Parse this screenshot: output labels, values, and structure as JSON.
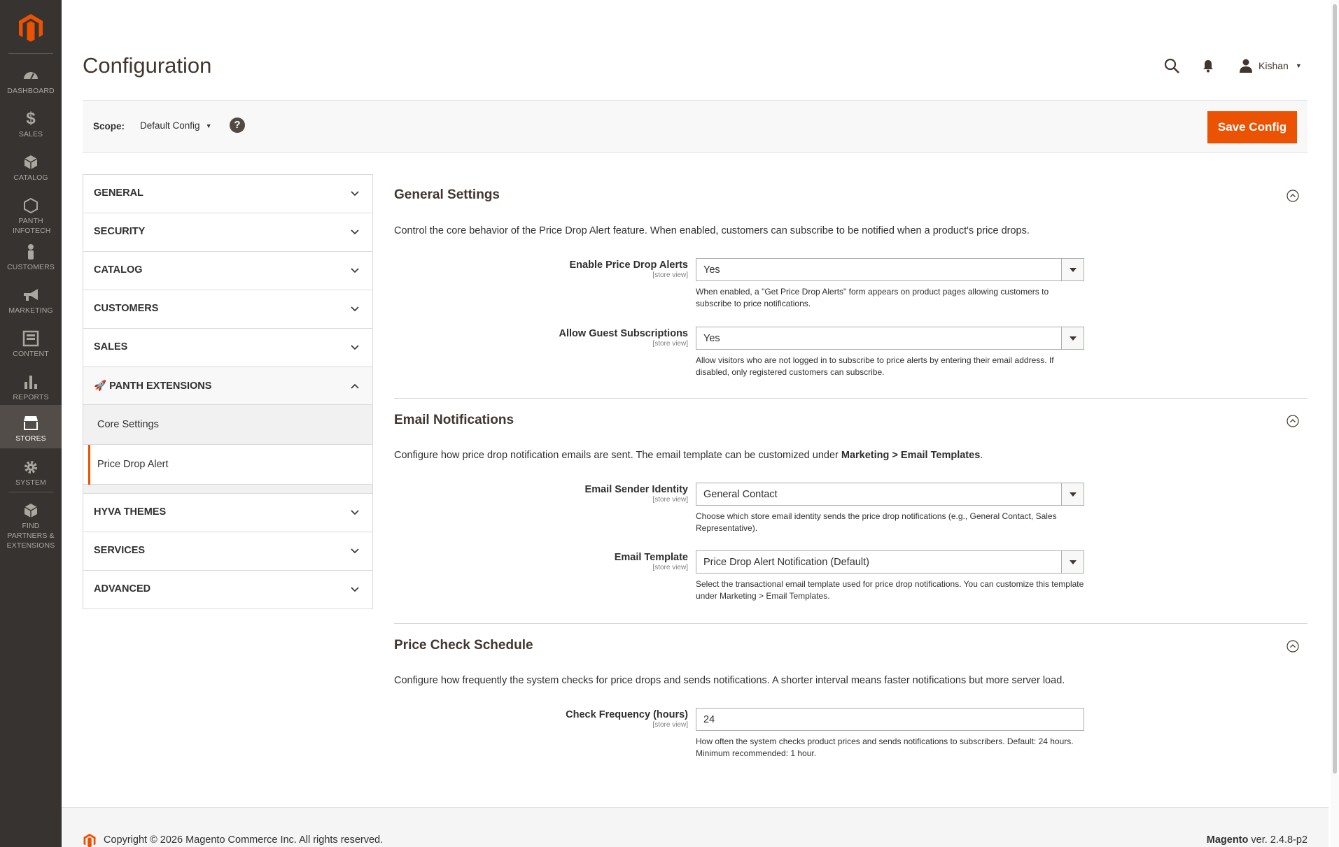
{
  "nav": {
    "items": [
      {
        "label": "DASHBOARD",
        "icon": "speedometer-icon"
      },
      {
        "label": "SALES",
        "icon": "dollar-icon"
      },
      {
        "label": "CATALOG",
        "icon": "cube-icon"
      },
      {
        "label": "PANTH INFOTECH",
        "icon": "hexagon-icon"
      },
      {
        "label": "CUSTOMERS",
        "icon": "person-icon"
      },
      {
        "label": "MARKETING",
        "icon": "megaphone-icon"
      },
      {
        "label": "CONTENT",
        "icon": "layout-icon"
      },
      {
        "label": "REPORTS",
        "icon": "bar-chart-icon"
      },
      {
        "label": "STORES",
        "icon": "store-icon",
        "active": true
      },
      {
        "label": "SYSTEM",
        "icon": "gear-icon"
      },
      {
        "label": "FIND PARTNERS & EXTENSIONS",
        "icon": "boxes-icon"
      }
    ]
  },
  "header": {
    "title": "Configuration",
    "user": "Kishan"
  },
  "scope": {
    "label": "Scope:",
    "value": "Default Config",
    "help": "?",
    "save_label": "Save Config"
  },
  "tabs": {
    "general": "GENERAL",
    "security": "SECURITY",
    "catalog": "CATALOG",
    "customers": "CUSTOMERS",
    "sales": "SALES",
    "panth": "🚀 PANTH EXTENSIONS",
    "panth_children": [
      "Core Settings",
      "Price Drop Alert"
    ],
    "hyva": "HYVA THEMES",
    "services": "SERVICES",
    "advanced": "ADVANCED"
  },
  "general_settings": {
    "title": "General Settings",
    "description": "Control the core behavior of the Price Drop Alert feature. When enabled, customers can subscribe to be notified when a product's price drops.",
    "enable": {
      "label": "Enable Price Drop Alerts",
      "scope": "[store view]",
      "value": "Yes",
      "note": "When enabled, a \"Get Price Drop Alerts\" form appears on product pages allowing customers to subscribe to price notifications."
    },
    "guest": {
      "label": "Allow Guest Subscriptions",
      "scope": "[store view]",
      "value": "Yes",
      "note": "Allow visitors who are not logged in to subscribe to price alerts by entering their email address. If disabled, only registered customers can subscribe."
    }
  },
  "email_notifications": {
    "title": "Email Notifications",
    "description_prefix": "Configure how price drop notification emails are sent. The email template can be customized under ",
    "description_bold": "Marketing > Email Templates",
    "description_suffix": ".",
    "sender": {
      "label": "Email Sender Identity",
      "scope": "[store view]",
      "value": "General Contact",
      "note": "Choose which store email identity sends the price drop notifications (e.g., General Contact, Sales Representative)."
    },
    "template": {
      "label": "Email Template",
      "scope": "[store view]",
      "value": "Price Drop Alert Notification (Default)",
      "note": "Select the transactional email template used for price drop notifications. You can customize this template under Marketing > Email Templates."
    }
  },
  "price_check": {
    "title": "Price Check Schedule",
    "description": "Configure how frequently the system checks for price drops and sends notifications. A shorter interval means faster notifications but more server load.",
    "frequency": {
      "label": "Check Frequency (hours)",
      "scope": "[store view]",
      "value": "24",
      "note": "How often the system checks product prices and sends notifications to subscribers. Default: 24 hours. Minimum recommended: 1 hour."
    }
  },
  "footer": {
    "copyright": "Copyright © 2026 Magento Commerce Inc. All rights reserved.",
    "brand": "Magento",
    "version": " ver. 2.4.8-p2"
  },
  "colors": {
    "accent": "#eb5202",
    "nav_bg": "#373330"
  }
}
